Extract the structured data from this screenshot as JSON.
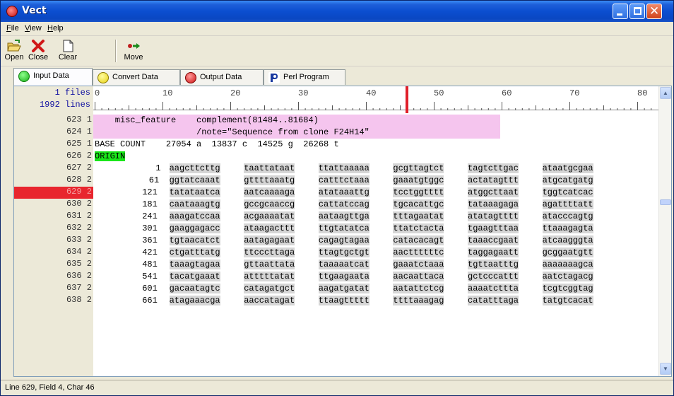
{
  "window": {
    "title": "Vect"
  },
  "menu": {
    "file": "File",
    "view": "View",
    "help": "Help"
  },
  "toolbar": {
    "open": "Open",
    "close": "Close",
    "clear": "Clear",
    "move": "Move"
  },
  "tabs": [
    {
      "label": "Input Data",
      "icon": "green-circle-icon",
      "color": "#22cc22",
      "active": true
    },
    {
      "label": "Convert Data",
      "icon": "yellow-circle-icon",
      "color": "#f0e020",
      "active": false
    },
    {
      "label": "Output Data",
      "icon": "red-circle-icon",
      "color": "#e02020",
      "active": false
    },
    {
      "label": "Perl Program",
      "icon": "perl-icon",
      "color": "#1030a0",
      "active": false
    }
  ],
  "editor": {
    "files_label": "1 files",
    "lines_label": "1992 lines",
    "ruler_numbers": [
      "0",
      "10",
      "20",
      "30",
      "40",
      "50",
      "60",
      "70",
      "80"
    ],
    "cursor_column": 46,
    "rows": [
      {
        "line": "623 1",
        "kind": "feature",
        "text": "    misc_feature    complement(81484..81684)"
      },
      {
        "line": "624 1",
        "kind": "feature",
        "text": "                    /note=\"Sequence from clone F24H14\""
      },
      {
        "line": "625 1",
        "kind": "plain",
        "text": "BASE COUNT    27054 a  13837 c  14525 g  26268 t"
      },
      {
        "line": "626 2",
        "kind": "origin",
        "text": "ORIGIN"
      },
      {
        "line": "627 2",
        "kind": "seq",
        "num": "1",
        "blocks": [
          "aagcttcttg",
          "taattataat",
          "ttattaaaaa",
          "gcgttagtct",
          "tagtcttgac",
          "ataatgcgaa"
        ]
      },
      {
        "line": "628 2",
        "kind": "seq",
        "num": "61",
        "blocks": [
          "ggtatcaaat",
          "gttttaaatg",
          "catttctaaa",
          "gaaatgtggc",
          "actatagttt",
          "atgcatgatg"
        ]
      },
      {
        "line": "629 2",
        "kind": "seq",
        "selected": true,
        "num": "121",
        "blocks": [
          "tatataatca",
          "aatcaaaaga",
          "atataaattg",
          "tcctggtttt",
          "atggcttaat",
          "tggtcatcac"
        ]
      },
      {
        "line": "630 2",
        "kind": "seq",
        "num": "181",
        "blocks": [
          "caataaagtg",
          "gccgcaaccg",
          "cattatccag",
          "tgcacattgc",
          "tataaagaga",
          "agattttatt"
        ]
      },
      {
        "line": "631 2",
        "kind": "seq",
        "num": "241",
        "blocks": [
          "aaagatccaa",
          "acgaaaatat",
          "aataagttga",
          "tttagaatat",
          "atatagtttt",
          "atacccagtg"
        ]
      },
      {
        "line": "632 2",
        "kind": "seq",
        "num": "301",
        "blocks": [
          "gaaggagacc",
          "ataagacttt",
          "ttgtatatca",
          "ttatctacta",
          "tgaagtttaa",
          "ttaaagagta"
        ]
      },
      {
        "line": "633 2",
        "kind": "seq",
        "num": "361",
        "blocks": [
          "tgtaacatct",
          "aatagagaat",
          "cagagtagaa",
          "catacacagt",
          "taaaccgaat",
          "atcaagggta"
        ]
      },
      {
        "line": "634 2",
        "kind": "seq",
        "num": "421",
        "blocks": [
          "ctgatttatg",
          "ttcccttaga",
          "ttagtgctgt",
          "aacttttttc",
          "taggagaatt",
          "gcggaatgtt"
        ]
      },
      {
        "line": "635 2",
        "kind": "seq",
        "num": "481",
        "blocks": [
          "taaagtagaa",
          "gttaattata",
          "taaaaatcat",
          "gaaatctaaa",
          "tgttaatttg",
          "aaaaaaagca"
        ]
      },
      {
        "line": "636 2",
        "kind": "seq",
        "num": "541",
        "blocks": [
          "tacatgaaat",
          "atttttatat",
          "ttgaagaata",
          "aacaattaca",
          "gctcccattt",
          "aatctagacg"
        ]
      },
      {
        "line": "637 2",
        "kind": "seq",
        "num": "601",
        "blocks": [
          "gacaatagtc",
          "catagatgct",
          "aagatgatat",
          "aatattctcg",
          "aaaatcttta",
          "tcgtcggtag"
        ]
      },
      {
        "line": "638 2",
        "kind": "seq",
        "num": "661",
        "blocks": [
          "atagaaacga",
          "aaccatagat",
          "ttaagttttt",
          "ttttaaagag",
          "catatttaga",
          "tatgtcacat"
        ]
      }
    ]
  },
  "status": {
    "text": "Line 629, Field 4, Char 46"
  }
}
